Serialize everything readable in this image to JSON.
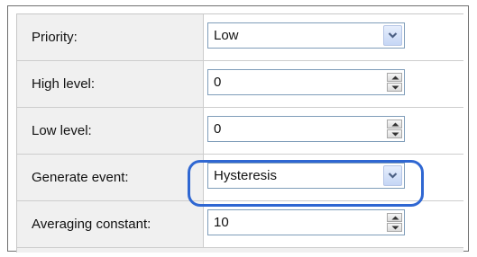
{
  "form": {
    "rows": [
      {
        "label": "Priority:",
        "value": "Low",
        "control": "dropdown"
      },
      {
        "label": "High level:",
        "value": "0",
        "control": "spinner"
      },
      {
        "label": "Low level:",
        "value": "0",
        "control": "spinner"
      },
      {
        "label": "Generate event:",
        "value": "Hysteresis",
        "control": "dropdown"
      },
      {
        "label": "Averaging constant:",
        "value": "10",
        "control": "spinner"
      }
    ]
  },
  "icons": {
    "dropdown": "chevron-down-icon",
    "spinner_up": "spin-up-icon",
    "spinner_down": "spin-down-icon"
  },
  "colors": {
    "highlight_ring": "#2f67d2",
    "field_border": "#7f9db9",
    "label_background": "#f0f0f0"
  }
}
